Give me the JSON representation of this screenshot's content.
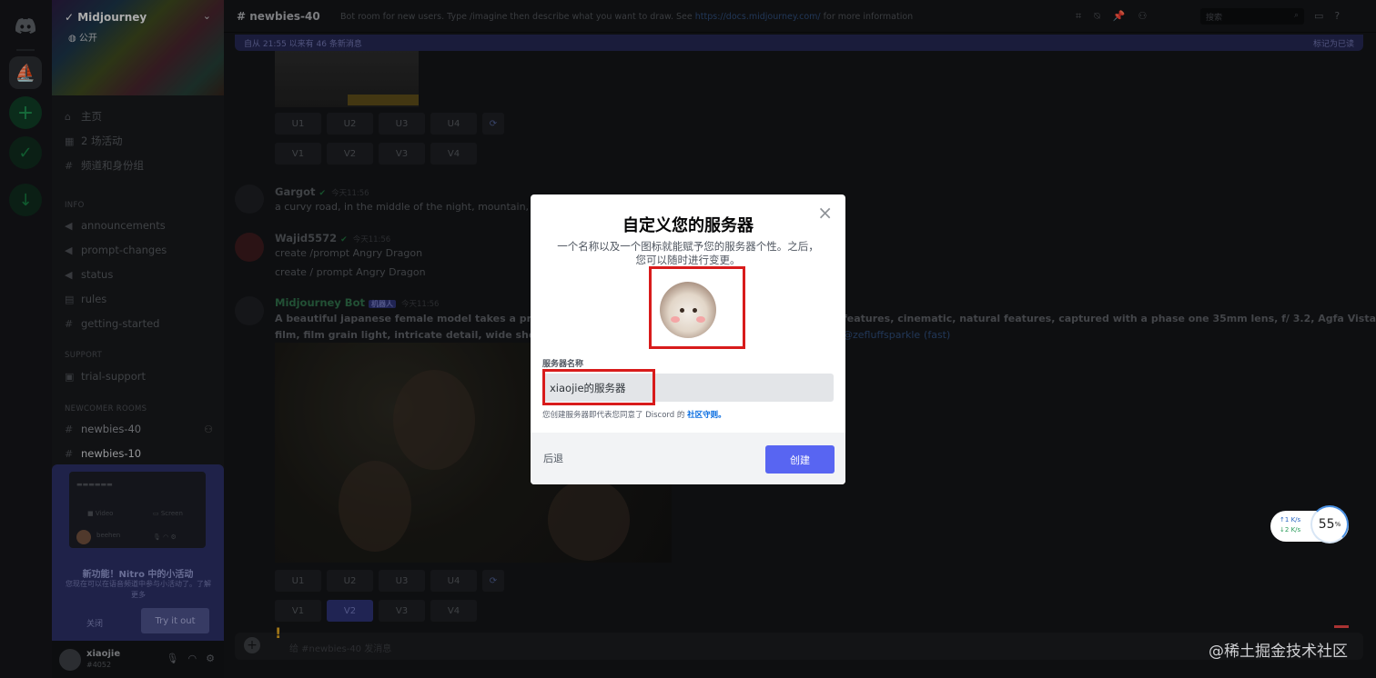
{
  "rail": {
    "icons": [
      "discord-logo",
      "midjourney-server",
      "add-server",
      "explore",
      "download"
    ],
    "add_symbol": "+"
  },
  "sidebar": {
    "server_name": "Midjourney",
    "public_label": "公开",
    "top_items": [
      {
        "icon": "home-icon",
        "label": "主页"
      },
      {
        "icon": "calendar-icon",
        "label": "2 场活动"
      },
      {
        "icon": "channels-icon",
        "label": "频道和身份组"
      }
    ],
    "categories": [
      {
        "title": "INFO",
        "channels": [
          "announcements",
          "prompt-changes",
          "status",
          "rules",
          "getting-started"
        ]
      },
      {
        "title": "SUPPORT",
        "channels": [
          "trial-support"
        ]
      },
      {
        "title": "NEWCOMER ROOMS",
        "channels": [
          "newbies-40",
          "newbies-10"
        ]
      }
    ],
    "nitro": {
      "title": "新功能！Nitro 中的小活动",
      "desc": "您现在可以在语音频道中参与小活动了。了解更多",
      "close_label": "关闭",
      "try_label": "Try it out",
      "preview_name": "beehen",
      "preview_video": "Video",
      "preview_screen": "Screen"
    },
    "user": {
      "name": "xiaojie",
      "tag": "#4052"
    }
  },
  "main": {
    "channel": "newbies-40",
    "topic": "Bot room for new users. Type /imagine then describe what you want to draw. See",
    "topic_link": "https://docs.midjourney.com/",
    "topic_tail": "for more information",
    "search_placeholder": "搜索",
    "newbar_left": "自从 21:55 以来有 46 条新消息",
    "newbar_right": "标记为已读",
    "upscale_row": [
      "U1",
      "U2",
      "U3",
      "U4"
    ],
    "variation_row": [
      "V1",
      "V2",
      "V3",
      "V4"
    ],
    "messages": [
      {
        "user": "Gargot",
        "time": "今天11:56",
        "text": "a curvy road, in the middle of the night, mountain, hi"
      },
      {
        "user": "Wajid5572",
        "time": "今天11:56",
        "text": "create /prompt Angry Dragon",
        "text2": "create / prompt Angry Dragon"
      },
      {
        "user": "Midjourney Bot",
        "badge": "机器人",
        "time": "今天11:56",
        "text": "A beautiful japanese female model takes a profes",
        "text_right": "features, cinematic, natural features, captured with a phase one 35mm lens, f/ 3.2, Agfa Vista",
        "text2": "film, film grain light, intricate detail, wide shot, ba",
        "mention": "@zefluffsparkle",
        "speed": "(fast)"
      }
    ],
    "input_placeholder": "给 #newbies-40 发消息"
  },
  "modal": {
    "title": "自定义您的服务器",
    "description": "一个名称以及一个图标就能赋予您的服务器个性。之后，您可以随时进行变更。",
    "field_label": "服务器名称",
    "field_value": "xiaojie的服务器",
    "tos_prefix": "您创建服务器即代表您同意了 Discord 的",
    "tos_link": "社区守则。",
    "back_label": "后退",
    "create_label": "创建",
    "close_symbol": "×"
  },
  "speed_widget": {
    "up_value": "1",
    "down_value": "2",
    "unit": "K/s",
    "percent": "55",
    "percent_sign": "%"
  },
  "watermark": "@稀土掘金技术社区",
  "colors": {
    "accent": "#5865f2",
    "highlight": "#d81b1b",
    "link": "#0068e0"
  }
}
